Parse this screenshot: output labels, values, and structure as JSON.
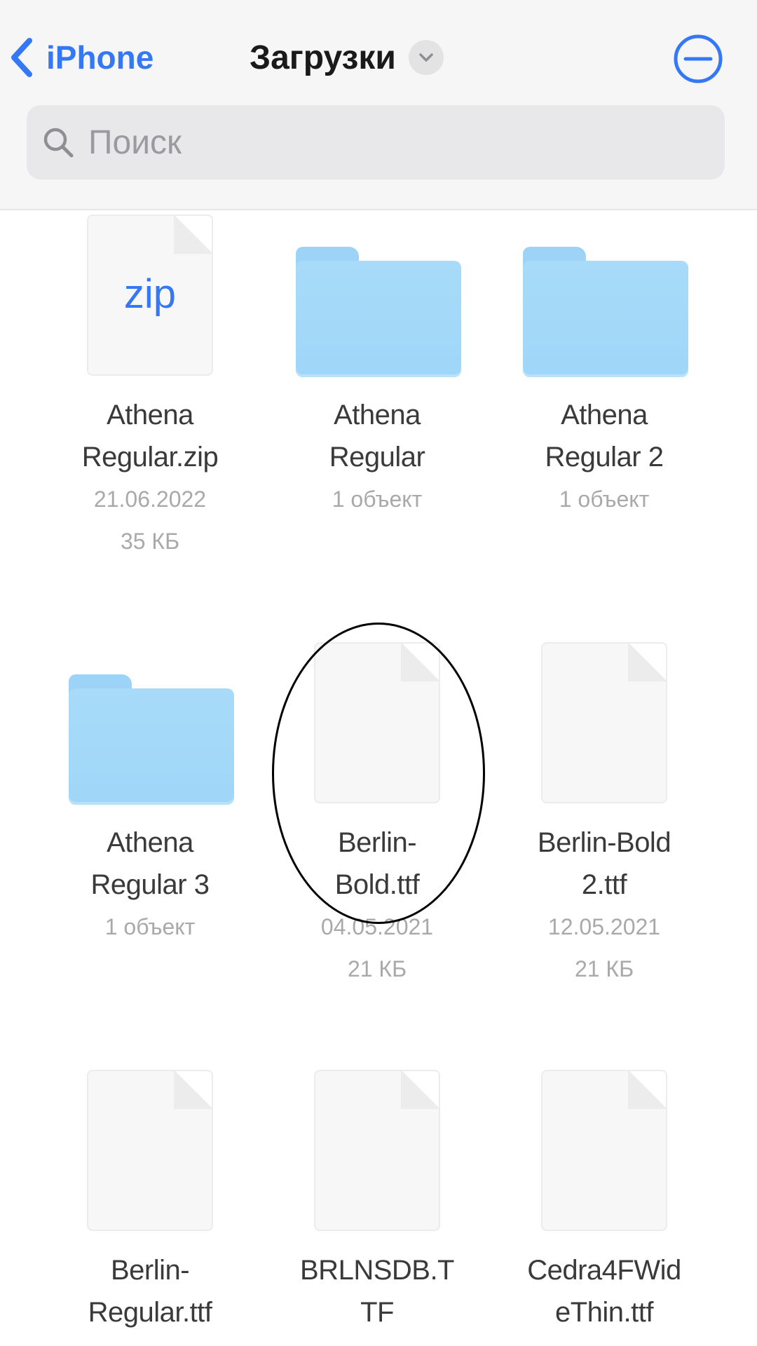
{
  "header": {
    "back_label": "iPhone",
    "title": "Загрузки",
    "more_icon": "ellipsis-circle-icon",
    "colors": {
      "accent": "#3478f6"
    }
  },
  "search": {
    "placeholder": "Поиск"
  },
  "files": [
    {
      "type": "zip",
      "ext": "zip",
      "name_line1": "Athena",
      "name_line2": "Regular.zip",
      "meta1": "21.06.2022",
      "meta2": "35 КБ"
    },
    {
      "type": "folder",
      "name_line1": "Athena",
      "name_line2": "Regular",
      "meta1": "1 объект",
      "meta2": ""
    },
    {
      "type": "folder",
      "name_line1": "Athena",
      "name_line2": "Regular 2",
      "meta1": "1 объект",
      "meta2": ""
    },
    {
      "type": "folder",
      "name_line1": "Athena",
      "name_line2": "Regular 3",
      "meta1": "1 объект",
      "meta2": ""
    },
    {
      "type": "doc",
      "name_line1": "Berlin-",
      "name_line2": "Bold.ttf",
      "meta1": "04.05.2021",
      "meta2": "21 КБ"
    },
    {
      "type": "doc",
      "name_line1": "Berlin-Bold",
      "name_line2": "2.ttf",
      "meta1": "12.05.2021",
      "meta2": "21 КБ"
    },
    {
      "type": "doc",
      "name_line1": "Berlin-",
      "name_line2": "Regular.ttf",
      "meta1": "",
      "meta2": ""
    },
    {
      "type": "doc",
      "name_line1": "BRLNSDB.T",
      "name_line2": "TF",
      "meta1": "",
      "meta2": ""
    },
    {
      "type": "doc",
      "name_line1": "Cedra4FWid",
      "name_line2": "eThin.ttf",
      "meta1": "",
      "meta2": ""
    }
  ]
}
